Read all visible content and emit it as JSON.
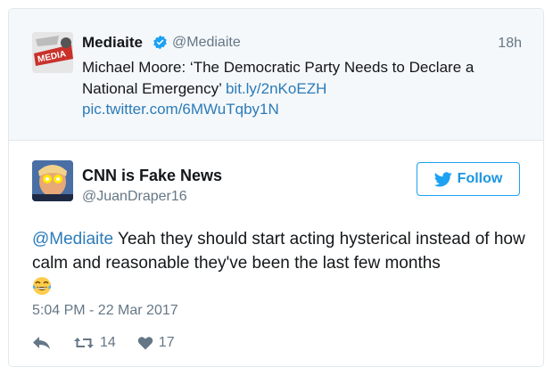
{
  "quoted": {
    "name": "Mediaite",
    "handle": "@Mediaite",
    "time": "18h",
    "text": "Michael Moore: ‘The Democratic Party Needs to Declare a National Emergency’",
    "link1": "bit.ly/2nKoEZH",
    "link2": "pic.twitter.com/6MWuTqby1N",
    "avatar_text": "MEDIA"
  },
  "tweet": {
    "name": "CNN is Fake News",
    "handle": "@JuanDraper16",
    "follow_label": "Follow",
    "mention": "@Mediaite",
    "text": " Yeah they should start acting hysterical instead of how calm and reasonable they've been the last few months",
    "emoji": "😂",
    "date": "5:04 PM - 22 Mar 2017",
    "retweets": "14",
    "likes": "17"
  },
  "icons": [
    "verified-badge-icon",
    "twitter-bird-icon",
    "reply-icon",
    "retweet-icon",
    "heart-icon",
    "laughing-emoji-icon"
  ],
  "colors": {
    "accent": "#1da1f2",
    "link": "#2b7bb9",
    "muted": "#657786",
    "quoted_bg": "#f5f8fa"
  }
}
